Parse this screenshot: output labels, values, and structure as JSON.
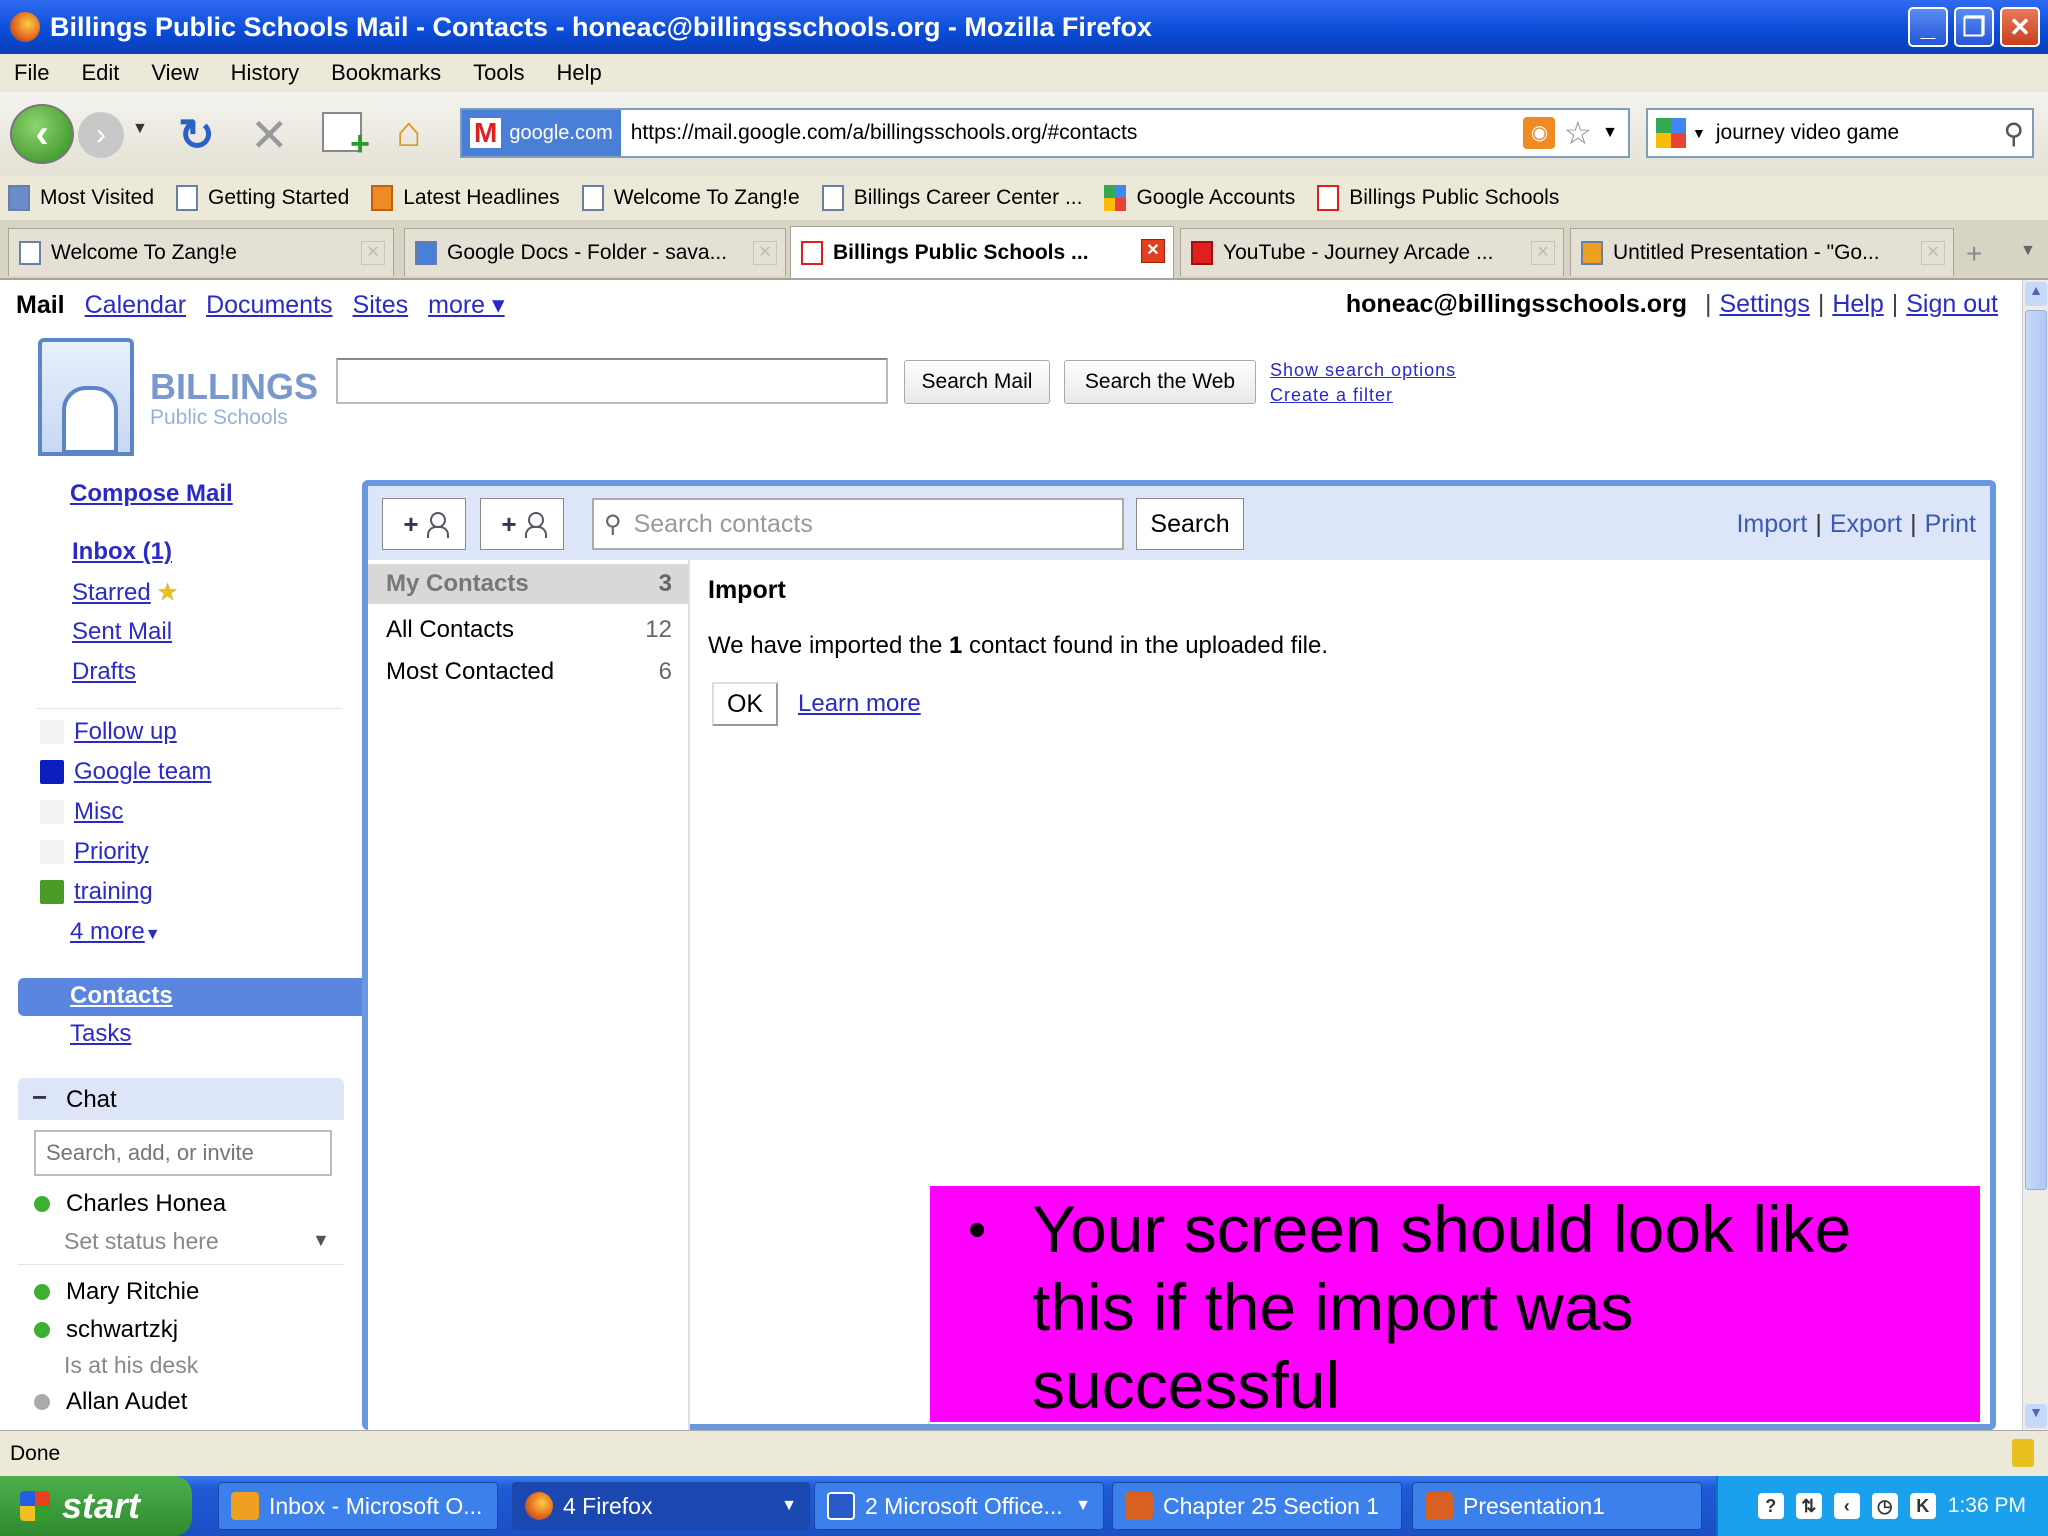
{
  "window": {
    "title": "Billings Public Schools Mail - Contacts - honeac@billingsschools.org - Mozilla Firefox",
    "minimize": "_",
    "restore": "❐",
    "close": "✕"
  },
  "menu": [
    "File",
    "Edit",
    "View",
    "History",
    "Bookmarks",
    "Tools",
    "Help"
  ],
  "nav": {
    "url_site": "google.com",
    "url": "https://mail.google.com/a/billingsschools.org/#contacts",
    "search_value": "journey video game"
  },
  "bookmarks": [
    "Most Visited",
    "Getting Started",
    "Latest Headlines",
    "Welcome To Zang!e",
    "Billings Career Center ...",
    "Google Accounts",
    "Billings Public Schools"
  ],
  "tabs": [
    "Welcome To Zang!e",
    "Google Docs - Folder - sava...",
    "Billings Public Schools ...",
    "YouTube - Journey Arcade ...",
    "Untitled Presentation - \"Go..."
  ],
  "topnav": {
    "mail": "Mail",
    "calendar": "Calendar",
    "documents": "Documents",
    "sites": "Sites",
    "more": "more ▾",
    "email": "honeac@billingsschools.org",
    "settings": "Settings",
    "help": "Help",
    "signout": "Sign out",
    "sep": "|"
  },
  "logo": {
    "line1": "BILLINGS",
    "line2": "Public Schools"
  },
  "mailsearch": {
    "search_mail": "Search Mail",
    "search_web": "Search the Web",
    "show_options": "Show search options",
    "create_filter": "Create a filter"
  },
  "leftnav": {
    "compose": "Compose Mail",
    "inbox": "Inbox (1)",
    "starred": "Starred",
    "sent": "Sent Mail",
    "drafts": "Drafts",
    "labels": [
      {
        "name": "Follow up",
        "color": "#f2f2f2"
      },
      {
        "name": "Google team",
        "color": "#0a1ec0"
      },
      {
        "name": "Misc",
        "color": "#f2f2f2"
      },
      {
        "name": "Priority",
        "color": "#f2f2f2"
      },
      {
        "name": "training",
        "color": "#4a9a28"
      }
    ],
    "more_labels": "4 more",
    "contacts": "Contacts",
    "tasks": "Tasks"
  },
  "chat": {
    "title": "Chat",
    "placeholder": "Search, add, or invite",
    "me": "Charles Honea",
    "me_status": "Set status here",
    "buddies": [
      {
        "name": "Mary Ritchie",
        "status": ""
      },
      {
        "name": "schwartzkj",
        "status": "Is at his desk"
      },
      {
        "name": "Allan Audet",
        "status": ""
      }
    ]
  },
  "contacts": {
    "search_placeholder": "Search contacts",
    "search_button": "Search",
    "import": "Import",
    "export": "Export",
    "print": "Print",
    "groups": [
      {
        "name": "My Contacts",
        "count": "3"
      },
      {
        "name": "All Contacts",
        "count": "12"
      },
      {
        "name": "Most Contacted",
        "count": "6"
      }
    ],
    "import_title": "Import",
    "msg_pre": "We have imported the ",
    "msg_count": "1",
    "msg_post": " contact found in the uploaded file.",
    "ok": "OK",
    "learn_more": "Learn more"
  },
  "callout": {
    "bullet": "•",
    "text": "Your screen should look like this if the import was successful"
  },
  "status": "Done",
  "taskbar": {
    "start": "start",
    "tasks": [
      "Inbox - Microsoft O...",
      "4 Firefox",
      "2 Microsoft Office...",
      "Chapter 25 Section 1",
      "Presentation1"
    ],
    "time": "1:36 PM"
  }
}
